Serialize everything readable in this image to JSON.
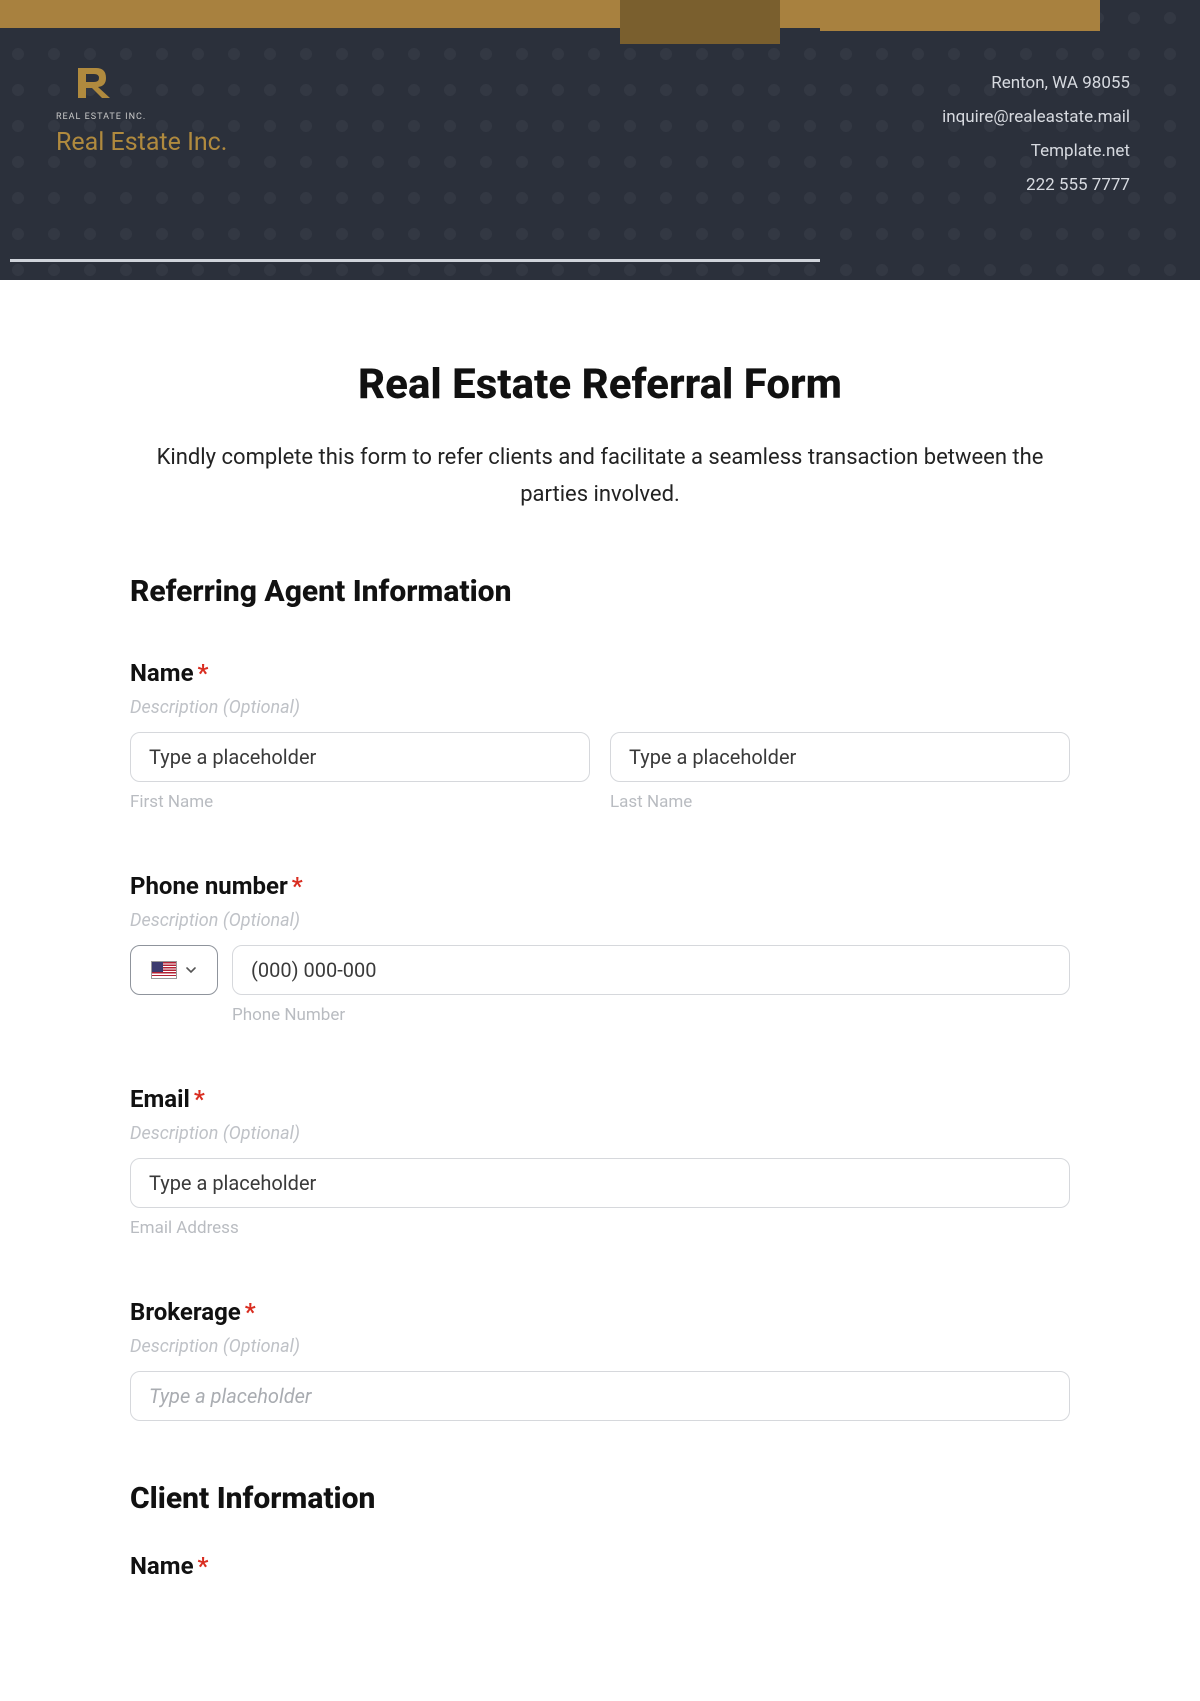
{
  "header": {
    "logo_sub": "REAL ESTATE INC.",
    "logo_name": "Real Estate Inc.",
    "contact": {
      "line1": "Renton, WA 98055",
      "line2": "inquire@realeastate.mail",
      "line3": "Template.net",
      "line4": "222 555 7777"
    }
  },
  "form": {
    "title": "Real Estate Referral Form",
    "intro": "Kindly complete this form to refer clients and facilitate a seamless transaction between the parties involved."
  },
  "sections": {
    "agent": {
      "heading": "Referring Agent Information",
      "name": {
        "label": "Name",
        "required_mark": "*",
        "desc": "Description (Optional)",
        "first_placeholder": "Type a placeholder",
        "first_sub": "First Name",
        "last_placeholder": "Type a placeholder",
        "last_sub": "Last Name"
      },
      "phone": {
        "label": "Phone number",
        "required_mark": "*",
        "desc": "Description (Optional)",
        "placeholder": "(000) 000-000",
        "sub": "Phone Number"
      },
      "email": {
        "label": "Email",
        "required_mark": "*",
        "desc": "Description (Optional)",
        "placeholder": "Type a placeholder",
        "sub": "Email Address"
      },
      "brokerage": {
        "label": "Brokerage",
        "required_mark": "*",
        "desc": "Description (Optional)",
        "placeholder": "Type a placeholder"
      }
    },
    "client": {
      "heading": "Client Information",
      "name": {
        "label": "Name",
        "required_mark": "*"
      }
    }
  }
}
